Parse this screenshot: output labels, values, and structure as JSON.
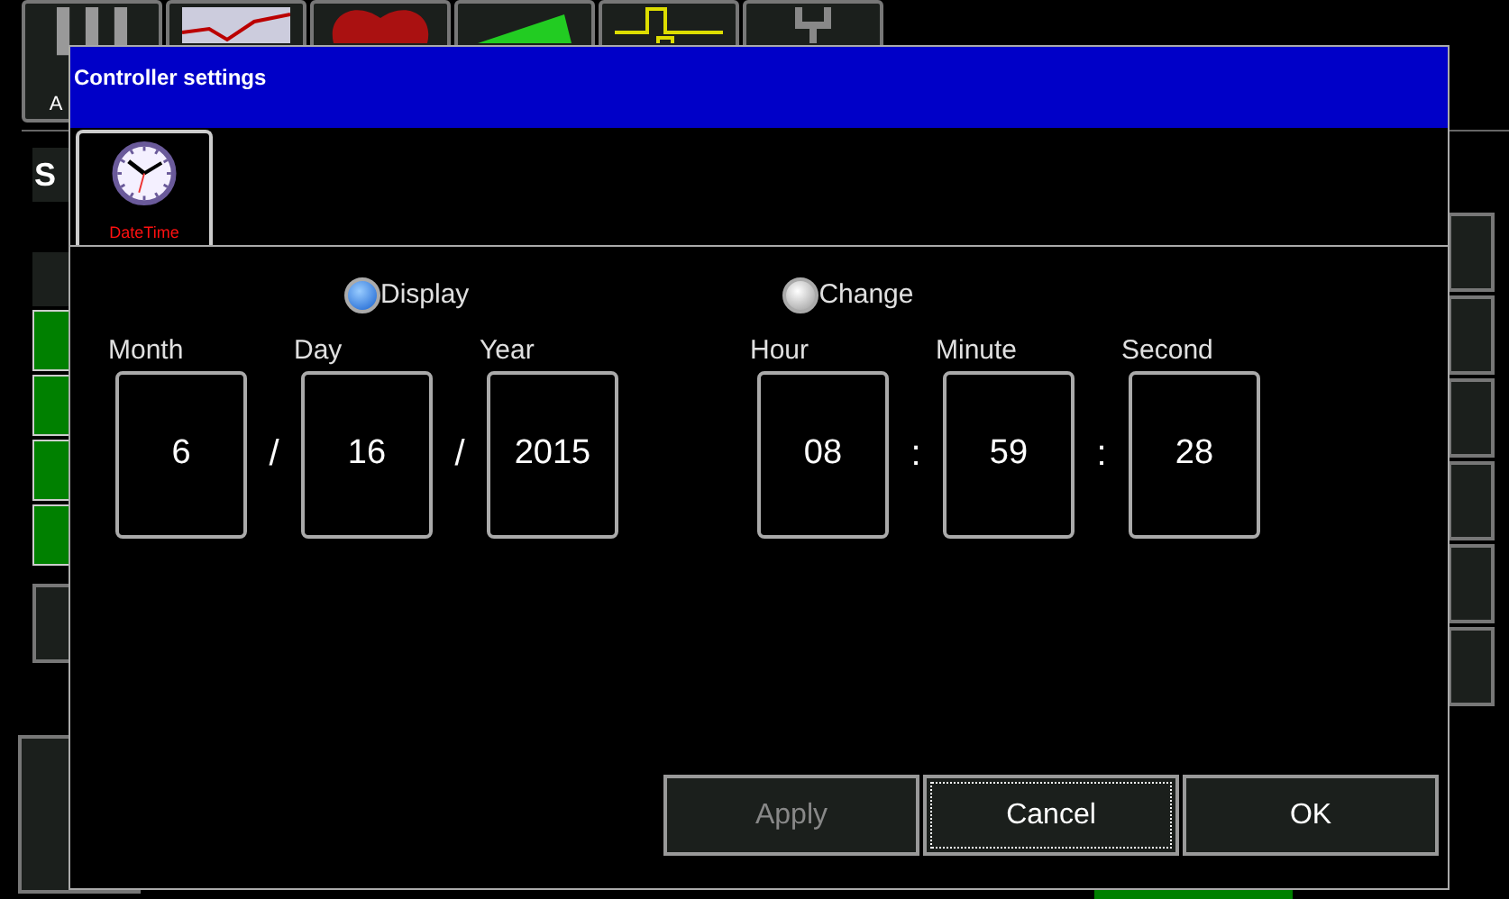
{
  "background": {
    "toolbar_label": "A",
    "side_label": "S"
  },
  "dialog": {
    "title": "Controller settings",
    "tabs": [
      {
        "label": "DateTime",
        "selected": true
      }
    ],
    "modes": [
      {
        "label": "Display",
        "selected": true
      },
      {
        "label": "Change",
        "selected": false
      }
    ],
    "date_fields": [
      {
        "label": "Month",
        "value": "6"
      },
      {
        "label": "Day",
        "value": "16"
      },
      {
        "label": "Year",
        "value": "2015"
      }
    ],
    "date_separators": [
      "/",
      "/"
    ],
    "time_fields": [
      {
        "label": "Hour",
        "value": "08"
      },
      {
        "label": "Minute",
        "value": "59"
      },
      {
        "label": "Second",
        "value": "28"
      }
    ],
    "time_separators": [
      ":",
      ":"
    ],
    "buttons": [
      {
        "label": "Apply",
        "disabled": true,
        "focused": false
      },
      {
        "label": "Cancel",
        "disabled": false,
        "focused": true
      },
      {
        "label": "OK",
        "disabled": false,
        "focused": false
      }
    ]
  }
}
